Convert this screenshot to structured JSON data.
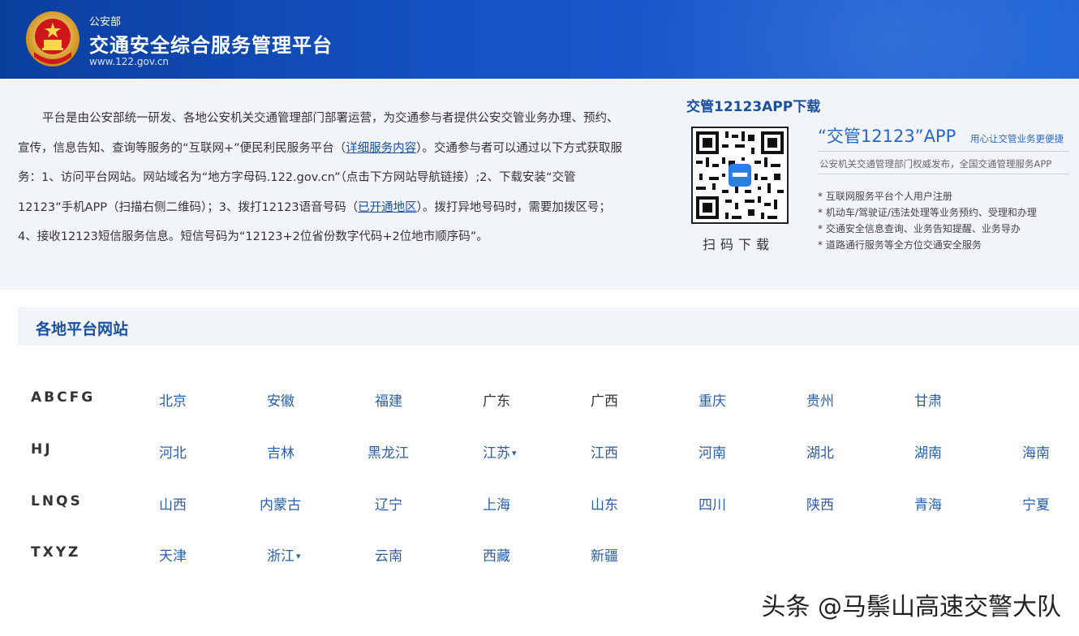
{
  "header": {
    "ministry": "公安部",
    "title": "交通安全综合服务管理平台",
    "url": "www.122.gov.cn"
  },
  "intro": {
    "p1": "平台是由公安部统一研发、各地公安机关交通管理部门部署运营，为交通参与者提供公安交管业务办理、预约、宣传，信息告知、查询等服务的“互联网+”便民利民服务平台（",
    "link1": "详细服务内容",
    "p2": "）。交通参与者可以通过以下方式获取服务：1、访问平台网站。网站域名为“地方字母码.122.gov.cn”（点击下方网站导航链接）;2、下载安装“交管12123”手机APP（扫描右侧二维码）；3、拨打12123语音号码（",
    "link2": "已开通地区",
    "p3": "）。拨打异地号码时，需要加拨区号；4、接收12123短信服务信息。短信号码为“12123+2位省份数字代码+2位地市顺序码”。"
  },
  "app": {
    "download_title": "交管12123APP下载",
    "qr_caption": "扫码下载",
    "name": "“交管12123”APP",
    "slogan": "用心让交管业务更便捷",
    "publisher": "公安机关交通管理部门权威发布，全国交通管理服务APP",
    "features": [
      "* 互联网服务平台个人用户注册",
      "* 机动车/驾驶证/违法处理等业务预约、受理和办理",
      "* 交通安全信息查询、业务告知提醒、业务导办",
      "* 道路通行服务等全方位交通安全服务"
    ]
  },
  "section": {
    "title": "各地平台网站"
  },
  "regions": [
    {
      "letters": "ABCFG",
      "provinces": [
        "北京",
        "安徽",
        "福建",
        "广东",
        "广西",
        "重庆",
        "贵州",
        "甘肃"
      ]
    },
    {
      "letters": "HJ",
      "provinces": [
        "河北",
        "吉林",
        "黑龙江",
        "江苏",
        "江西",
        "河南",
        "湖北",
        "湖南",
        "海南"
      ]
    },
    {
      "letters": "LNQS",
      "provinces": [
        "山西",
        "内蒙古",
        "辽宁",
        "上海",
        "山东",
        "四川",
        "陕西",
        "青海",
        "宁夏"
      ]
    },
    {
      "letters": "TXYZ",
      "provinces": [
        "天津",
        "浙江",
        "云南",
        "西藏",
        "新疆"
      ]
    }
  ],
  "dropdown_caret": "▾",
  "watermark": "头条 @马鬃山高速交警大队",
  "colors": {
    "header_blue": "#1553c6",
    "link_blue": "#2b5ea8",
    "title_blue": "#1b4fa0",
    "band_bg": "#f1f5fa"
  }
}
